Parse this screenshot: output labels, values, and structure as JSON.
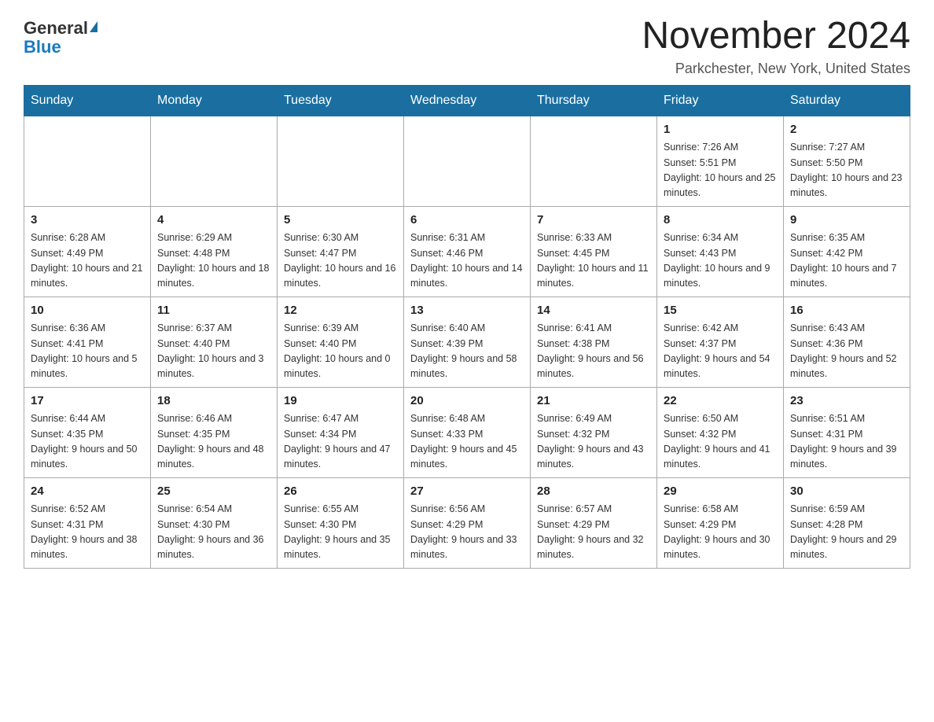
{
  "header": {
    "logo_general": "General",
    "logo_blue": "Blue",
    "month_title": "November 2024",
    "location": "Parkchester, New York, United States"
  },
  "days_of_week": [
    "Sunday",
    "Monday",
    "Tuesday",
    "Wednesday",
    "Thursday",
    "Friday",
    "Saturday"
  ],
  "weeks": [
    [
      {
        "day": null
      },
      {
        "day": null
      },
      {
        "day": null
      },
      {
        "day": null
      },
      {
        "day": null
      },
      {
        "day": 1,
        "sunrise": "Sunrise: 7:26 AM",
        "sunset": "Sunset: 5:51 PM",
        "daylight": "Daylight: 10 hours and 25 minutes."
      },
      {
        "day": 2,
        "sunrise": "Sunrise: 7:27 AM",
        "sunset": "Sunset: 5:50 PM",
        "daylight": "Daylight: 10 hours and 23 minutes."
      }
    ],
    [
      {
        "day": 3,
        "sunrise": "Sunrise: 6:28 AM",
        "sunset": "Sunset: 4:49 PM",
        "daylight": "Daylight: 10 hours and 21 minutes."
      },
      {
        "day": 4,
        "sunrise": "Sunrise: 6:29 AM",
        "sunset": "Sunset: 4:48 PM",
        "daylight": "Daylight: 10 hours and 18 minutes."
      },
      {
        "day": 5,
        "sunrise": "Sunrise: 6:30 AM",
        "sunset": "Sunset: 4:47 PM",
        "daylight": "Daylight: 10 hours and 16 minutes."
      },
      {
        "day": 6,
        "sunrise": "Sunrise: 6:31 AM",
        "sunset": "Sunset: 4:46 PM",
        "daylight": "Daylight: 10 hours and 14 minutes."
      },
      {
        "day": 7,
        "sunrise": "Sunrise: 6:33 AM",
        "sunset": "Sunset: 4:45 PM",
        "daylight": "Daylight: 10 hours and 11 minutes."
      },
      {
        "day": 8,
        "sunrise": "Sunrise: 6:34 AM",
        "sunset": "Sunset: 4:43 PM",
        "daylight": "Daylight: 10 hours and 9 minutes."
      },
      {
        "day": 9,
        "sunrise": "Sunrise: 6:35 AM",
        "sunset": "Sunset: 4:42 PM",
        "daylight": "Daylight: 10 hours and 7 minutes."
      }
    ],
    [
      {
        "day": 10,
        "sunrise": "Sunrise: 6:36 AM",
        "sunset": "Sunset: 4:41 PM",
        "daylight": "Daylight: 10 hours and 5 minutes."
      },
      {
        "day": 11,
        "sunrise": "Sunrise: 6:37 AM",
        "sunset": "Sunset: 4:40 PM",
        "daylight": "Daylight: 10 hours and 3 minutes."
      },
      {
        "day": 12,
        "sunrise": "Sunrise: 6:39 AM",
        "sunset": "Sunset: 4:40 PM",
        "daylight": "Daylight: 10 hours and 0 minutes."
      },
      {
        "day": 13,
        "sunrise": "Sunrise: 6:40 AM",
        "sunset": "Sunset: 4:39 PM",
        "daylight": "Daylight: 9 hours and 58 minutes."
      },
      {
        "day": 14,
        "sunrise": "Sunrise: 6:41 AM",
        "sunset": "Sunset: 4:38 PM",
        "daylight": "Daylight: 9 hours and 56 minutes."
      },
      {
        "day": 15,
        "sunrise": "Sunrise: 6:42 AM",
        "sunset": "Sunset: 4:37 PM",
        "daylight": "Daylight: 9 hours and 54 minutes."
      },
      {
        "day": 16,
        "sunrise": "Sunrise: 6:43 AM",
        "sunset": "Sunset: 4:36 PM",
        "daylight": "Daylight: 9 hours and 52 minutes."
      }
    ],
    [
      {
        "day": 17,
        "sunrise": "Sunrise: 6:44 AM",
        "sunset": "Sunset: 4:35 PM",
        "daylight": "Daylight: 9 hours and 50 minutes."
      },
      {
        "day": 18,
        "sunrise": "Sunrise: 6:46 AM",
        "sunset": "Sunset: 4:35 PM",
        "daylight": "Daylight: 9 hours and 48 minutes."
      },
      {
        "day": 19,
        "sunrise": "Sunrise: 6:47 AM",
        "sunset": "Sunset: 4:34 PM",
        "daylight": "Daylight: 9 hours and 47 minutes."
      },
      {
        "day": 20,
        "sunrise": "Sunrise: 6:48 AM",
        "sunset": "Sunset: 4:33 PM",
        "daylight": "Daylight: 9 hours and 45 minutes."
      },
      {
        "day": 21,
        "sunrise": "Sunrise: 6:49 AM",
        "sunset": "Sunset: 4:32 PM",
        "daylight": "Daylight: 9 hours and 43 minutes."
      },
      {
        "day": 22,
        "sunrise": "Sunrise: 6:50 AM",
        "sunset": "Sunset: 4:32 PM",
        "daylight": "Daylight: 9 hours and 41 minutes."
      },
      {
        "day": 23,
        "sunrise": "Sunrise: 6:51 AM",
        "sunset": "Sunset: 4:31 PM",
        "daylight": "Daylight: 9 hours and 39 minutes."
      }
    ],
    [
      {
        "day": 24,
        "sunrise": "Sunrise: 6:52 AM",
        "sunset": "Sunset: 4:31 PM",
        "daylight": "Daylight: 9 hours and 38 minutes."
      },
      {
        "day": 25,
        "sunrise": "Sunrise: 6:54 AM",
        "sunset": "Sunset: 4:30 PM",
        "daylight": "Daylight: 9 hours and 36 minutes."
      },
      {
        "day": 26,
        "sunrise": "Sunrise: 6:55 AM",
        "sunset": "Sunset: 4:30 PM",
        "daylight": "Daylight: 9 hours and 35 minutes."
      },
      {
        "day": 27,
        "sunrise": "Sunrise: 6:56 AM",
        "sunset": "Sunset: 4:29 PM",
        "daylight": "Daylight: 9 hours and 33 minutes."
      },
      {
        "day": 28,
        "sunrise": "Sunrise: 6:57 AM",
        "sunset": "Sunset: 4:29 PM",
        "daylight": "Daylight: 9 hours and 32 minutes."
      },
      {
        "day": 29,
        "sunrise": "Sunrise: 6:58 AM",
        "sunset": "Sunset: 4:29 PM",
        "daylight": "Daylight: 9 hours and 30 minutes."
      },
      {
        "day": 30,
        "sunrise": "Sunrise: 6:59 AM",
        "sunset": "Sunset: 4:28 PM",
        "daylight": "Daylight: 9 hours and 29 minutes."
      }
    ]
  ]
}
